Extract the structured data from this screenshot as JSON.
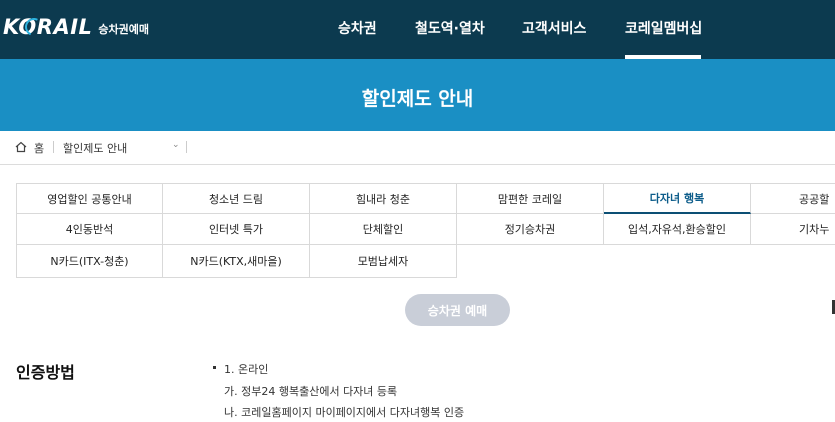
{
  "header": {
    "logo_text": "KORAIL",
    "logo_sub": "승차권예매",
    "nav": [
      {
        "label": "승차권"
      },
      {
        "label": "철도역·열차"
      },
      {
        "label": "고객서비스"
      },
      {
        "label": "코레일멤버십"
      }
    ]
  },
  "banner": {
    "title": "할인제도 안내"
  },
  "breadcrumb": {
    "home": "홈",
    "current": "할인제도 안내"
  },
  "tabs": {
    "row1": [
      "영업할인 공통안내",
      "청소년 드림",
      "힘내라 청춘",
      "맘편한 코레일",
      "다자녀 행복",
      "공공할"
    ],
    "row2": [
      "4인동반석",
      "인터넷 특가",
      "단체할인",
      "정기승차권",
      "입석,자유석,환승할인",
      "기차누"
    ],
    "row3": [
      "N카드(ITX-청춘)",
      "N카드(KTX,새마을)",
      "모범납세자"
    ],
    "active": "다자녀 행복"
  },
  "reserve_button": "승차권 예매",
  "section": {
    "title": "인증방법",
    "lines": [
      "1. 온라인",
      "가. 정부24 행복출산에서 다자녀 등록",
      "나. 코레일홈페이지 마이페이지에서 다자녀행복 인증"
    ]
  }
}
